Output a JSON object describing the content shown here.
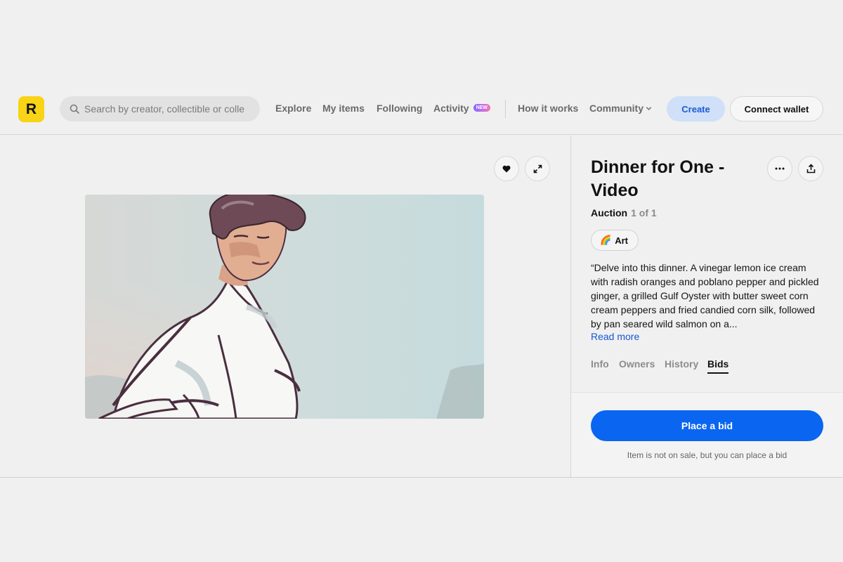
{
  "header": {
    "logo_letter": "R",
    "search_placeholder": "Search by creator, collectible or colle",
    "nav": {
      "explore": "Explore",
      "my_items": "My items",
      "following": "Following",
      "activity": "Activity",
      "activity_badge": "NEW",
      "how_it_works": "How it works",
      "community": "Community"
    },
    "create_label": "Create",
    "connect_wallet_label": "Connect wallet"
  },
  "item": {
    "title": "Dinner for One - Video",
    "sale_type": "Auction",
    "edition": "1 of 1",
    "tag_emoji": "🌈",
    "tag_label": "Art",
    "description": "“Delve into this dinner. A vinegar lemon ice cream with radish oranges and poblano pepper and pickled ginger, a grilled Gulf Oyster with butter sweet corn cream peppers and fried candied corn silk, followed by pan seared wild salmon on a...",
    "read_more": "Read more"
  },
  "tabs": [
    {
      "label": "Info",
      "active": false
    },
    {
      "label": "Owners",
      "active": false
    },
    {
      "label": "History",
      "active": false
    },
    {
      "label": "Bids",
      "active": true
    }
  ],
  "bid": {
    "button_label": "Place a bid",
    "note": "Item is not on sale, but you can place a bid"
  },
  "colors": {
    "brand_yellow": "#f8d316",
    "primary_blue": "#0a66f0",
    "create_bg": "#cfe0f8"
  },
  "icons": [
    "search-icon",
    "heart-icon",
    "expand-icon",
    "more-icon",
    "share-icon",
    "chevron-down-icon"
  ]
}
